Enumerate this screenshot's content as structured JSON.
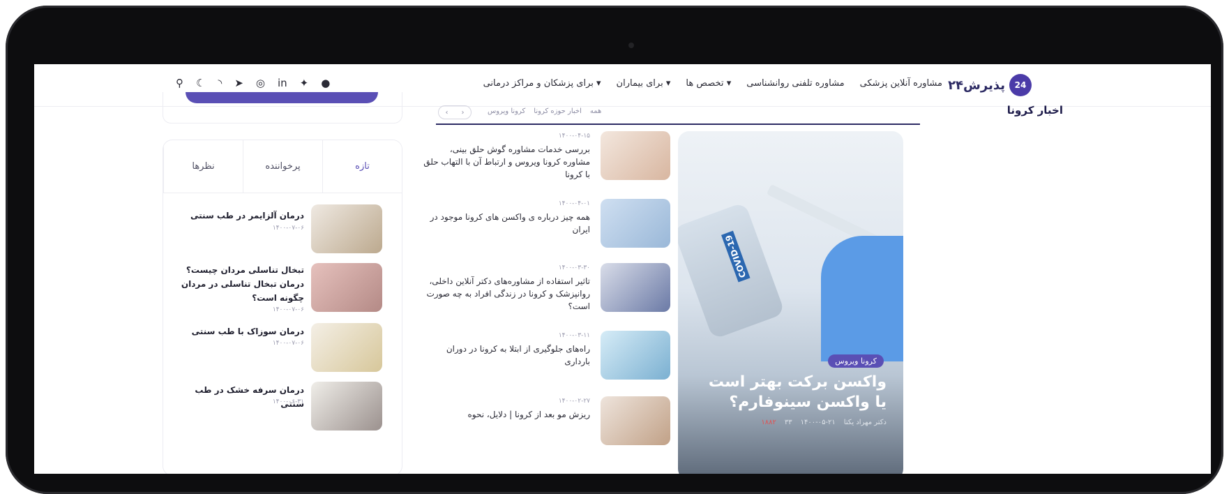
{
  "brand": {
    "logo_badge": "24",
    "logo_text": "پذیرش۲۴"
  },
  "nav": {
    "items": [
      "مشاوره آنلاین پزشکی",
      "مشاوره تلفنی روانشناسی",
      "تخصص ها ▾",
      "برای بیماران ▾",
      "برای پزشکان و مراکز درمانی ▾"
    ],
    "icons": [
      {
        "name": "search-icon",
        "glyph": "⚲"
      },
      {
        "name": "moon-icon",
        "glyph": "☾"
      },
      {
        "name": "rss-icon",
        "glyph": "◝"
      },
      {
        "name": "telegram-icon",
        "glyph": "➤"
      },
      {
        "name": "instagram-icon",
        "glyph": "◎"
      },
      {
        "name": "linkedin-icon",
        "glyph": "in"
      },
      {
        "name": "twitter-icon",
        "glyph": "✦"
      },
      {
        "name": "github-icon",
        "glyph": "●"
      }
    ]
  },
  "section": {
    "title": "اخبار کرونا",
    "tabs": [
      "همه",
      "اخبار حوزه کرونا",
      "کرونا ویروس"
    ],
    "arrows": [
      "‹",
      "›"
    ]
  },
  "widget": {
    "tabs": [
      "تازه",
      "پرخواننده",
      "نظرها"
    ],
    "posts": [
      {
        "title": "درمان آلزایمر در طب سنتی",
        "date": "۱۴۰۰-۰۷-۰۶"
      },
      {
        "title": "تبخال تناسلی مردان چیست؟ درمان تبخال تناسلی در مردان چگونه است؟",
        "date": "۱۴۰۰-۰۷-۰۶"
      },
      {
        "title": "درمان سوزاک با طب سنتی",
        "date": "۱۴۰۰-۰۷-۰۶"
      },
      {
        "title": "درمان سرفه خشک در طب سنتی",
        "date": "۱۴۰۰-۰۶-۳۱"
      }
    ]
  },
  "news": [
    {
      "date": "۱۴۰۰-۰۴-۱۵",
      "title": "بررسی خدمات مشاوره گوش حلق بینی، مشاوره کرونا ویروس و ارتباط آن با التهاب حلق با کرونا"
    },
    {
      "date": "۱۴۰۰-۰۴-۰۱",
      "title": "همه چیز درباره ی واکسن های کرونا موجود در ایران"
    },
    {
      "date": "۱۴۰۰-۰۳-۳۰",
      "title": "تاثیر استفاده از مشاوره‌های دکتر آنلاین داخلی، روانپزشک و کرونا در زندگی افراد به چه صورت است؟"
    },
    {
      "date": "۱۴۰۰-۰۳-۱۱",
      "title": "راه‌های جلوگیری از ابتلا به کرونا در دوران بارداری"
    },
    {
      "date": "۱۴۰۰-۰۲-۲۷",
      "title": "ریزش مو بعد از کرونا | دلایل، نحوه"
    }
  ],
  "feature": {
    "badge": "کرونا ویروس",
    "title": "واکسن برکت بهتر است یا واکسن سینوفارم؟",
    "vial_label": "COVID-19",
    "author": "دکتر مهراد یکتا",
    "date": "۱۴۰۰-۰۵-۲۱",
    "comments": "۳۳",
    "views": "۱۸۸۲"
  }
}
